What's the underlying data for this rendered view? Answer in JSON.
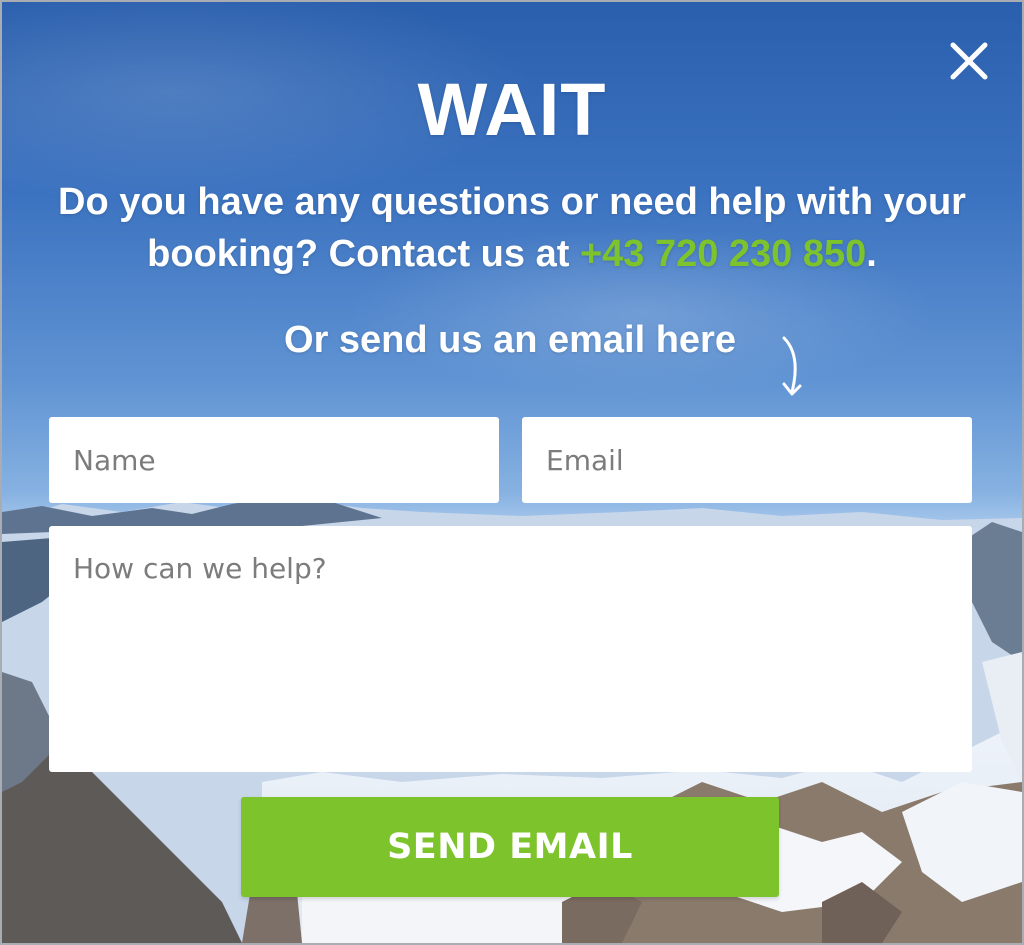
{
  "modal": {
    "title": "WAIT",
    "question_text": "Do you have any questions or need help with your booking? Contact us at ",
    "phone": "+43 720 230 850",
    "question_end": ".",
    "email_prompt": "Or send us an email here",
    "close_icon": "close-icon",
    "arrow_icon": "curved-arrow-down-icon"
  },
  "form": {
    "name_placeholder": "Name",
    "email_placeholder": "Email",
    "message_placeholder": "How can we help?",
    "submit_label": "SEND EMAIL"
  },
  "colors": {
    "accent_green": "#7dc42c",
    "sky_blue": "#2a5fad",
    "text_white": "#ffffff"
  }
}
